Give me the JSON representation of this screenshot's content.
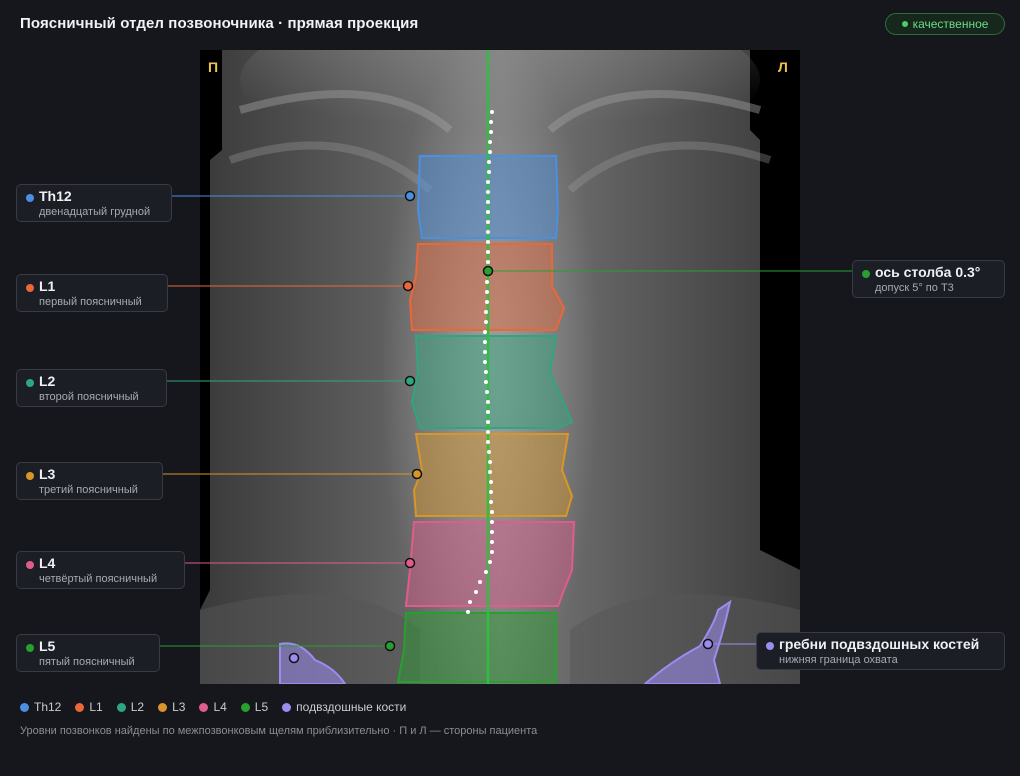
{
  "header": {
    "title": "Поясничный отдел позвоночника · прямая проекция",
    "badge": "качественное",
    "badge_color": "#4ccc6b"
  },
  "viewer": {
    "side_right": "П",
    "side_left": "Л",
    "axis_color": "#2fbf3f"
  },
  "vertebrae": [
    {
      "id": "th12",
      "name": "Th12",
      "desc": "двенадцатый грудной",
      "color": "#4a90e2"
    },
    {
      "id": "l1",
      "name": "L1",
      "desc": "первый поясничный",
      "color": "#e8683a"
    },
    {
      "id": "l2",
      "name": "L2",
      "desc": "второй поясничный",
      "color": "#2fa67f"
    },
    {
      "id": "l3",
      "name": "L3",
      "desc": "третий поясничный",
      "color": "#d89628"
    },
    {
      "id": "l4",
      "name": "L4",
      "desc": "четвёртый поясничный",
      "color": "#e05c8c"
    },
    {
      "id": "l5",
      "name": "L5",
      "desc": "пятый поясничный",
      "color": "#27a02e"
    }
  ],
  "axis_card": {
    "title": "ось столба 0.3°",
    "sub": "допуск 5° по Т3",
    "color": "#27a02e"
  },
  "iliac_card": {
    "title": "гребни подвздошных костей",
    "sub": "нижняя граница охвата",
    "color": "#9c8cf0"
  },
  "legend": [
    {
      "label": "Th12",
      "color": "#4a90e2"
    },
    {
      "label": "L1",
      "color": "#e8683a"
    },
    {
      "label": "L2",
      "color": "#2fa67f"
    },
    {
      "label": "L3",
      "color": "#d89628"
    },
    {
      "label": "L4",
      "color": "#e05c8c"
    },
    {
      "label": "L5",
      "color": "#27a02e"
    },
    {
      "label": "подвздошные кости",
      "color": "#9c8cf0"
    }
  ],
  "footnote": "Уровни позвонков найдены по межпозвонковым щелям приблизительно · П и Л — стороны пациента"
}
